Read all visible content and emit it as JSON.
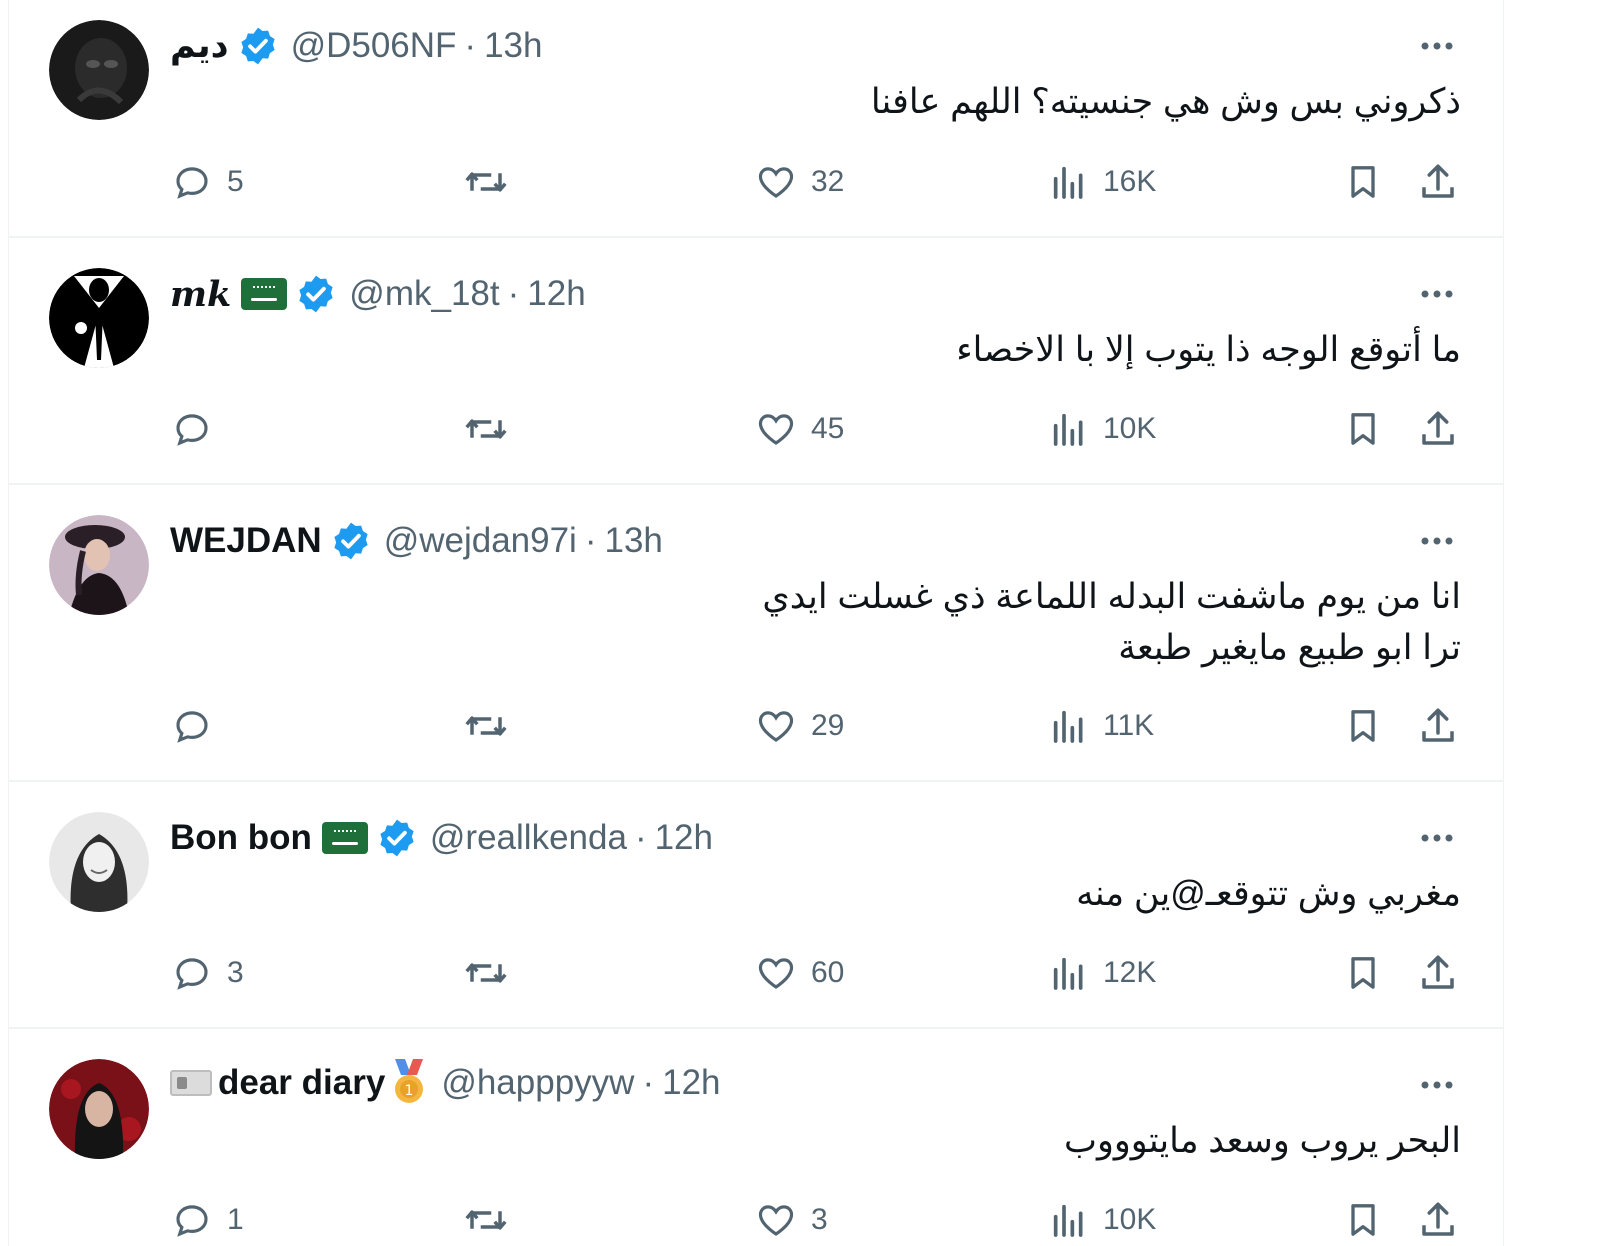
{
  "tweets": [
    {
      "name": "ديم",
      "handle": "@D506NF",
      "separator": "·",
      "time": "13h",
      "lines": [
        "ذكروني بس وش هي جنسيته؟ اللهم عافنا"
      ],
      "replies": "5",
      "likes": "32",
      "views": "16K"
    },
    {
      "name": "mk",
      "handle": "@mk_18t",
      "separator": "·",
      "time": "12h",
      "lines": [
        "ما أتوقع الوجه ذا يتوب إلا با الاخصاء"
      ],
      "replies": "",
      "likes": "45",
      "views": "10K"
    },
    {
      "name": "WEJDAN",
      "handle": "@wejdan97i",
      "separator": "·",
      "time": "13h",
      "lines": [
        "انا من يوم ماشفت البدله اللماعة ذي غسلت ايدي",
        "ترا ابو طبيع مايغير طبعة"
      ],
      "replies": "",
      "likes": "29",
      "views": "11K"
    },
    {
      "name": "Bon bon",
      "handle": "@reallkenda",
      "separator": "·",
      "time": "12h",
      "lines": [
        "مغربي وش تتوقعـ@ين منه"
      ],
      "replies": "3",
      "likes": "60",
      "views": "12K"
    },
    {
      "name": "dear diary",
      "handle": "@happpyyw",
      "separator": "·",
      "time": "12h",
      "lines": [
        "البحر يروب وسعد مايتوووب"
      ],
      "replies": "1",
      "likes": "3",
      "views": "10K"
    }
  ],
  "icons": {
    "verified": "verified-badge-icon",
    "flag": "saudi-flag-emoji",
    "more": "more-dots-icon",
    "reply": "reply-icon",
    "retweet": "retweet-icon",
    "like": "heart-icon",
    "views": "views-chart-icon",
    "bookmark": "bookmark-icon",
    "share": "share-icon",
    "id_card": "id-card-emoji",
    "medal": "first-place-medal-emoji"
  },
  "colors": {
    "text": "#0f1419",
    "muted": "#536471",
    "verified": "#1d9bf0",
    "border": "#eff3f4",
    "flag": "#1f6f3a"
  }
}
